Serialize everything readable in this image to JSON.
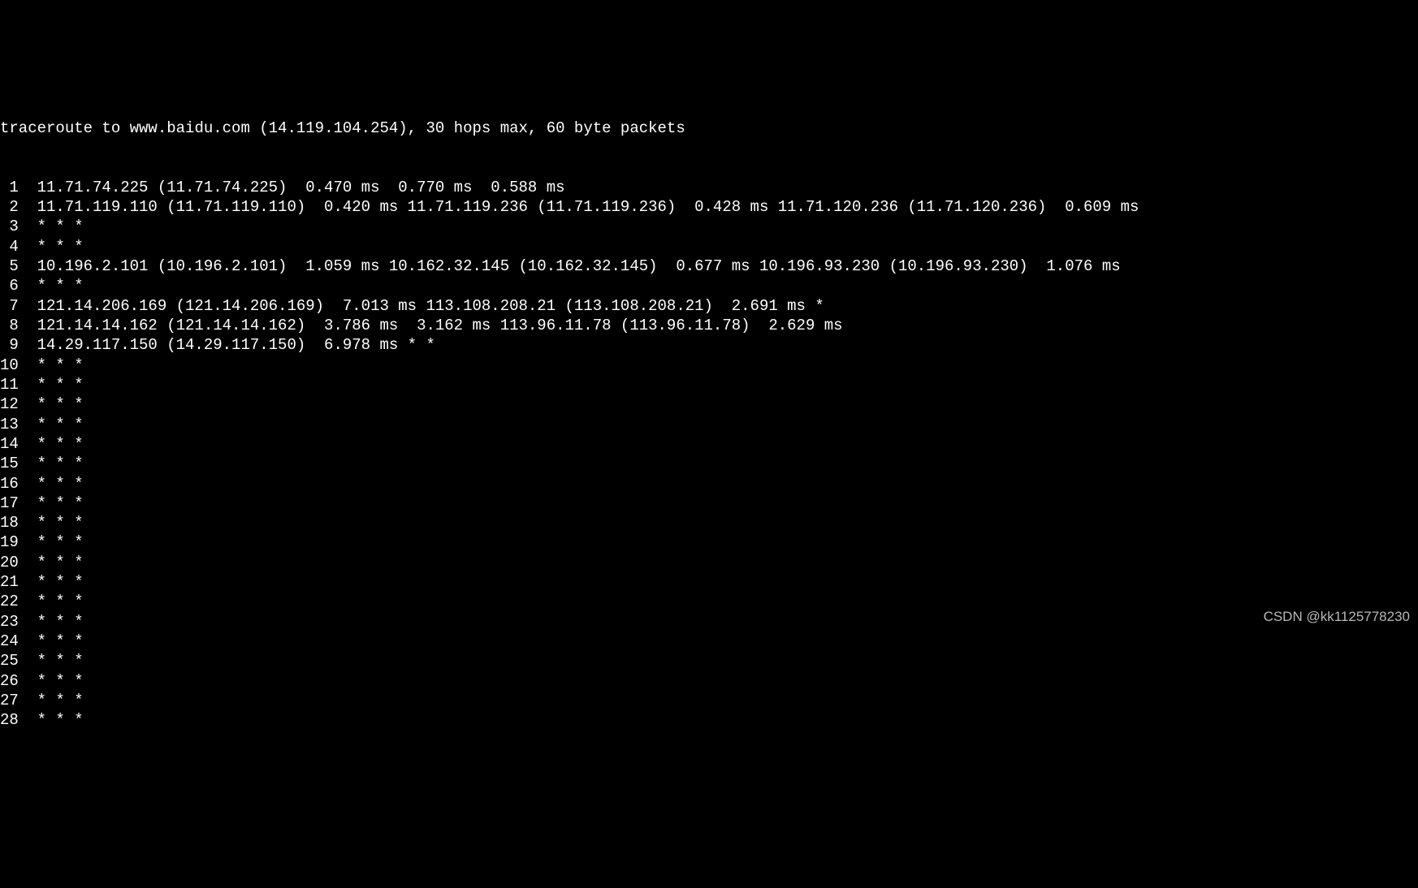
{
  "header": "traceroute to www.baidu.com (14.119.104.254), 30 hops max, 60 byte packets",
  "hops": [
    {
      "num": "1",
      "rest": "  11.71.74.225 (11.71.74.225)  0.470 ms  0.770 ms  0.588 ms"
    },
    {
      "num": "2",
      "rest": "  11.71.119.110 (11.71.119.110)  0.420 ms 11.71.119.236 (11.71.119.236)  0.428 ms 11.71.120.236 (11.71.120.236)  0.609 ms"
    },
    {
      "num": "3",
      "rest": "  * * *"
    },
    {
      "num": "4",
      "rest": "  * * *"
    },
    {
      "num": "5",
      "rest": "  10.196.2.101 (10.196.2.101)  1.059 ms 10.162.32.145 (10.162.32.145)  0.677 ms 10.196.93.230 (10.196.93.230)  1.076 ms"
    },
    {
      "num": "6",
      "rest": "  * * *"
    },
    {
      "num": "7",
      "rest": "  121.14.206.169 (121.14.206.169)  7.013 ms 113.108.208.21 (113.108.208.21)  2.691 ms *"
    },
    {
      "num": "8",
      "rest": "  121.14.14.162 (121.14.14.162)  3.786 ms  3.162 ms 113.96.11.78 (113.96.11.78)  2.629 ms"
    },
    {
      "num": "9",
      "rest": "  14.29.117.150 (14.29.117.150)  6.978 ms * *"
    },
    {
      "num": "10",
      "rest": "  * * *"
    },
    {
      "num": "11",
      "rest": "  * * *"
    },
    {
      "num": "12",
      "rest": "  * * *"
    },
    {
      "num": "13",
      "rest": "  * * *"
    },
    {
      "num": "14",
      "rest": "  * * *"
    },
    {
      "num": "15",
      "rest": "  * * *"
    },
    {
      "num": "16",
      "rest": "  * * *"
    },
    {
      "num": "17",
      "rest": "  * * *"
    },
    {
      "num": "18",
      "rest": "  * * *"
    },
    {
      "num": "19",
      "rest": "  * * *"
    },
    {
      "num": "20",
      "rest": "  * * *"
    },
    {
      "num": "21",
      "rest": "  * * *"
    },
    {
      "num": "22",
      "rest": "  * * *"
    },
    {
      "num": "23",
      "rest": "  * * *"
    },
    {
      "num": "24",
      "rest": "  * * *"
    },
    {
      "num": "25",
      "rest": "  * * *"
    },
    {
      "num": "26",
      "rest": "  * * *"
    },
    {
      "num": "27",
      "rest": "  * * *"
    },
    {
      "num": "28",
      "rest": "  * * *"
    }
  ],
  "watermark": "CSDN @kk1125778230"
}
